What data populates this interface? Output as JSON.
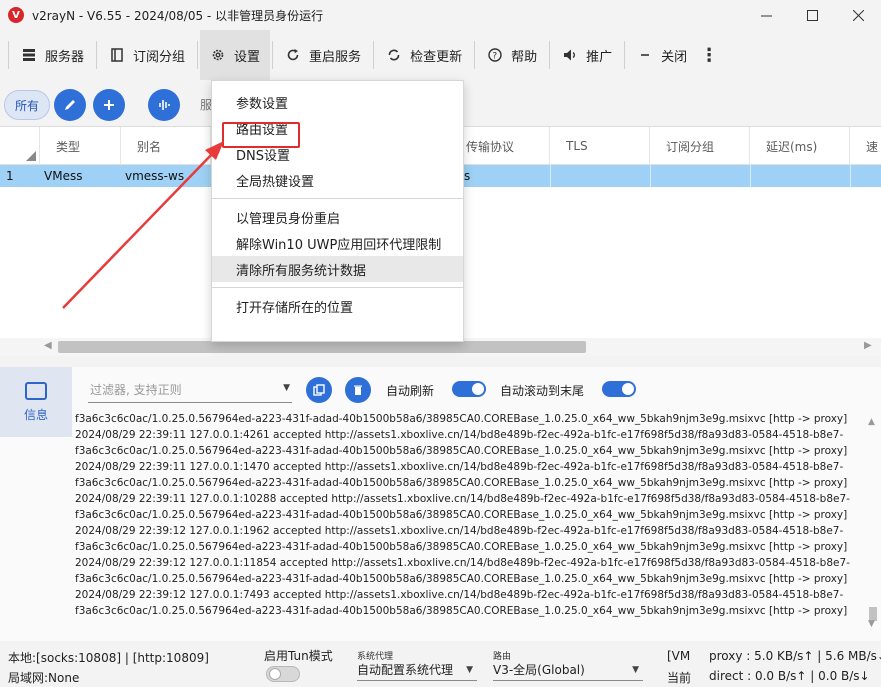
{
  "window": {
    "title": "v2rayN - V6.55 - 2024/08/05 - 以非管理员身份运行",
    "logo_letter": "V"
  },
  "toolbar": {
    "servers": "服务器",
    "sub_group": "订阅分组",
    "settings": "设置",
    "restart": "重启服务",
    "check_update": "检查更新",
    "help": "帮助",
    "promote": "推广",
    "close": "关闭"
  },
  "filter_row": {
    "all": "所有",
    "partial_label": "服"
  },
  "grid": {
    "columns": [
      "类型",
      "别名",
      "传输协议",
      "TLS",
      "订阅分组",
      "延迟(ms)",
      "速"
    ],
    "rows": [
      {
        "index": "1",
        "type": "VMess",
        "alias": "vmess-ws",
        "transport_tail": "s"
      }
    ]
  },
  "settings_menu": {
    "items": [
      "参数设置",
      "路由设置",
      "DNS设置",
      "全局热键设置",
      "以管理员身份重启",
      "解除Win10 UWP应用回环代理限制",
      "清除所有服务统计数据",
      "打开存储所在的位置"
    ],
    "highlighted": "路由设置",
    "hovered": "清除所有服务统计数据"
  },
  "log_panel": {
    "tab_label": "信息",
    "filter_placeholder": "过滤器, 支持正则",
    "auto_refresh": "自动刷新",
    "auto_scroll": "自动滚动到末尾",
    "lines": [
      "f3a6c3c6c0ac/1.0.25.0.567964ed-a223-431f-adad-40b1500b58a6/38985CA0.COREBase_1.0.25.0_x64_ww_5bkah9njm3e9g.msixvc [http -> proxy]",
      "2024/08/29 22:39:11 127.0.0.1:4261 accepted http://assets1.xboxlive.cn/14/bd8e489b-f2ec-492a-b1fc-e17f698f5d38/f8a93d83-0584-4518-b8e7-",
      "f3a6c3c6c0ac/1.0.25.0.567964ed-a223-431f-adad-40b1500b58a6/38985CA0.COREBase_1.0.25.0_x64_ww_5bkah9njm3e9g.msixvc [http -> proxy]",
      "2024/08/29 22:39:11 127.0.0.1:1470 accepted http://assets1.xboxlive.cn/14/bd8e489b-f2ec-492a-b1fc-e17f698f5d38/f8a93d83-0584-4518-b8e7-",
      "f3a6c3c6c0ac/1.0.25.0.567964ed-a223-431f-adad-40b1500b58a6/38985CA0.COREBase_1.0.25.0_x64_ww_5bkah9njm3e9g.msixvc [http -> proxy]",
      "2024/08/29 22:39:11 127.0.0.1:10288 accepted http://assets1.xboxlive.cn/14/bd8e489b-f2ec-492a-b1fc-e17f698f5d38/f8a93d83-0584-4518-b8e7-",
      "f3a6c3c6c0ac/1.0.25.0.567964ed-a223-431f-adad-40b1500b58a6/38985CA0.COREBase_1.0.25.0_x64_ww_5bkah9njm3e9g.msixvc [http -> proxy]",
      "2024/08/29 22:39:12 127.0.0.1:1962 accepted http://assets1.xboxlive.cn/14/bd8e489b-f2ec-492a-b1fc-e17f698f5d38/f8a93d83-0584-4518-b8e7-",
      "f3a6c3c6c0ac/1.0.25.0.567964ed-a223-431f-adad-40b1500b58a6/38985CA0.COREBase_1.0.25.0_x64_ww_5bkah9njm3e9g.msixvc [http -> proxy]",
      "2024/08/29 22:39:12 127.0.0.1:11854 accepted http://assets1.xboxlive.cn/14/bd8e489b-f2ec-492a-b1fc-e17f698f5d38/f8a93d83-0584-4518-b8e7-",
      "f3a6c3c6c0ac/1.0.25.0.567964ed-a223-431f-adad-40b1500b58a6/38985CA0.COREBase_1.0.25.0_x64_ww_5bkah9njm3e9g.msixvc [http -> proxy]",
      "2024/08/29 22:39:12 127.0.0.1:7493 accepted http://assets1.xboxlive.cn/14/bd8e489b-f2ec-492a-b1fc-e17f698f5d38/f8a93d83-0584-4518-b8e7-",
      "f3a6c3c6c0ac/1.0.25.0.567964ed-a223-431f-adad-40b1500b58a6/38985CA0.COREBase_1.0.25.0_x64_ww_5bkah9njm3e9g.msixvc [http -> proxy]"
    ]
  },
  "status_bar": {
    "local": "本地:[socks:10808] | [http:10809]",
    "lan": "局域网:None",
    "tun_label": "启用Tun模式",
    "sys_proxy_caption": "系统代理",
    "sys_proxy_value": "自动配置系统代理",
    "routing_caption": "路由",
    "routing_value": "V3-全局(Global)",
    "server_tag": "[VM",
    "current_tag": "当前",
    "proxy_speed": "proxy : 5.0 KB/s↑ | 5.6 MB/s↓",
    "direct_speed": "direct : 0.0 B/s↑ | 0.0 B/s↓"
  },
  "colors": {
    "accent": "#2e6fd8",
    "selected_row": "#9ed1f5",
    "highlight_box": "#e02c2c",
    "annotation_arrow": "#e83a3a"
  }
}
